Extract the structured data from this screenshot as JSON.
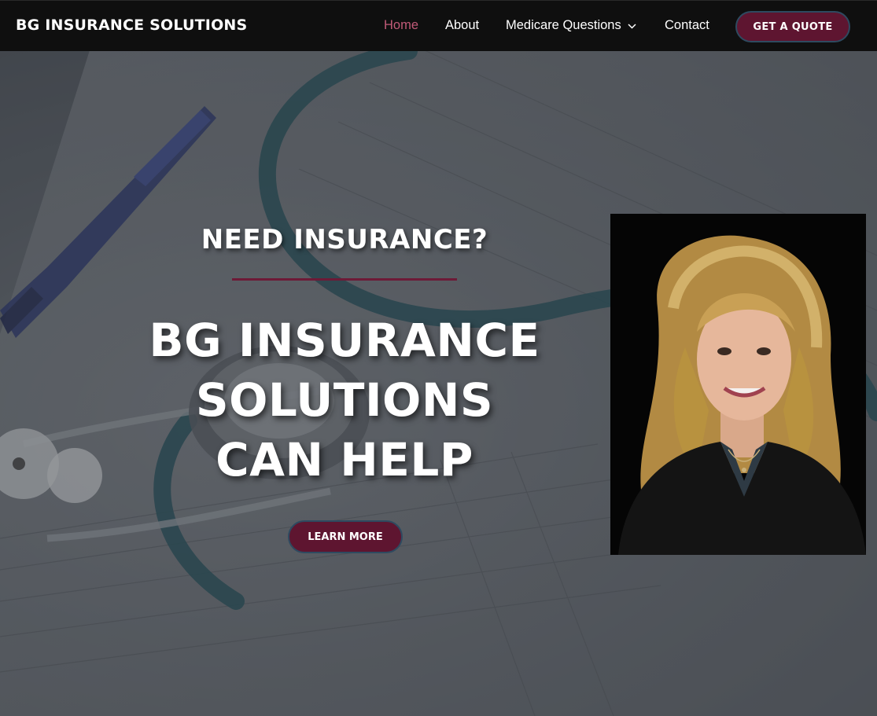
{
  "header": {
    "brand": "BG INSURANCE SOLUTIONS",
    "nav": [
      {
        "label": "Home",
        "active": true
      },
      {
        "label": "About"
      },
      {
        "label": "Medicare Questions",
        "has_dropdown": true
      },
      {
        "label": "Contact"
      }
    ],
    "cta_label": "GET A QUOTE"
  },
  "hero": {
    "kicker": "NEED INSURANCE?",
    "headline_lines": [
      "BG INSURANCE",
      "SOLUTIONS",
      "CAN HELP"
    ],
    "button_label": "LEARN MORE"
  },
  "colors": {
    "accent": "#5e1530",
    "active_nav": "#c15a78",
    "header_bg": "#0f0f0f"
  }
}
